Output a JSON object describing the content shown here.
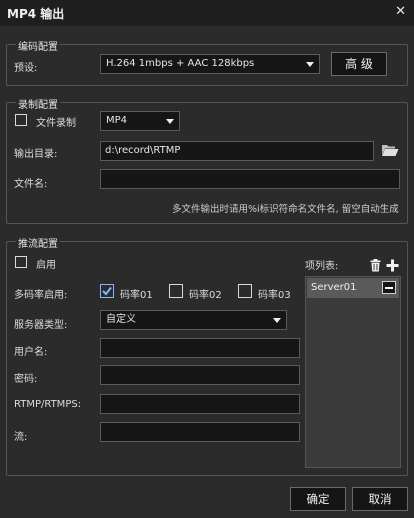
{
  "window": {
    "title": "MP4 输出",
    "close_glyph": "✕"
  },
  "encoding": {
    "group_label": "编码配置",
    "preset_label": "预设:",
    "preset_value": "H.264 1mbps + AAC 128kbps",
    "advanced_button": "高 级"
  },
  "recording": {
    "group_label": "录制配置",
    "file_record_label": "文件录制",
    "file_record_checked": false,
    "format_value": "MP4",
    "output_dir_label": "输出目录:",
    "output_dir_value": "d:\\record\\RTMP",
    "filename_label": "文件名:",
    "filename_value": "",
    "note": "多文件输出时请用%i标识符命名文件名, 留空自动生成"
  },
  "streaming": {
    "group_label": "推流配置",
    "enable_label": "启用",
    "enable_checked": false,
    "multi_bitrate_label": "多码率启用:",
    "bitrates": [
      {
        "label": "码率01",
        "checked": true
      },
      {
        "label": "码率02",
        "checked": false
      },
      {
        "label": "码率03",
        "checked": false
      }
    ],
    "server_type_label": "服务器类型:",
    "server_type_value": "自定义",
    "username_label": "用户名:",
    "username_value": "",
    "password_label": "密码:",
    "password_value": "",
    "rtmp_label": "RTMP/RTMPS:",
    "rtmp_value": "",
    "stream_label": "流:",
    "stream_value": "",
    "items_label": "项列表:",
    "items": [
      "Server01"
    ]
  },
  "footer": {
    "ok_button": "确定",
    "cancel_button": "取消"
  },
  "colors": {
    "background": "#2b2b2b",
    "titlebar": "#1f1f1f",
    "accent_check": "#8ab4ff"
  },
  "icons": [
    "close-icon",
    "chevron-down-icon",
    "folder-icon",
    "trash-icon",
    "plus-icon",
    "minus-icon",
    "check-icon"
  ]
}
